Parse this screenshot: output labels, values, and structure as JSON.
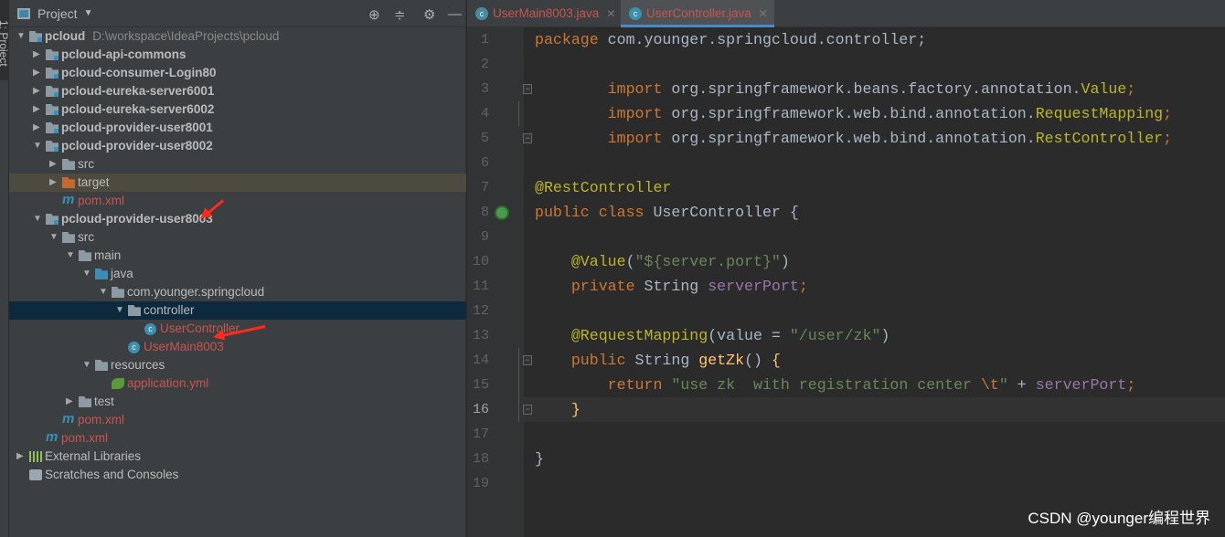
{
  "side_strip": {
    "label": "1: Project"
  },
  "project_panel": {
    "title": "Project",
    "toolbar_icons": [
      "locate-icon",
      "collapse-all-icon",
      "gear-icon",
      "minimize-icon"
    ],
    "tree": [
      {
        "level": 0,
        "arrow": "open",
        "icon": "module",
        "label": "pcloud",
        "path": "D:\\workspace\\IdeaProjects\\pcloud",
        "style": "bold"
      },
      {
        "level": 1,
        "arrow": "closed",
        "icon": "module",
        "label": "pcloud-api-commons",
        "style": "bold"
      },
      {
        "level": 1,
        "arrow": "closed",
        "icon": "module",
        "label": "pcloud-consumer-Login80",
        "style": "bold"
      },
      {
        "level": 1,
        "arrow": "closed",
        "icon": "module",
        "label": "pcloud-eureka-server6001",
        "style": "bold"
      },
      {
        "level": 1,
        "arrow": "closed",
        "icon": "module",
        "label": "pcloud-eureka-server6002",
        "style": "bold"
      },
      {
        "level": 1,
        "arrow": "closed",
        "icon": "module",
        "label": "pcloud-provider-user8001",
        "style": "bold"
      },
      {
        "level": 1,
        "arrow": "open",
        "icon": "module",
        "label": "pcloud-provider-user8002",
        "style": "bold"
      },
      {
        "level": 2,
        "arrow": "closed",
        "icon": "folder",
        "label": "src",
        "style": "normal"
      },
      {
        "level": 2,
        "arrow": "closed",
        "icon": "excluded-folder",
        "label": "target",
        "style": "normal",
        "row": "highlighted"
      },
      {
        "level": 2,
        "arrow": "none",
        "icon": "maven",
        "label": "pom.xml",
        "style": "red"
      },
      {
        "level": 1,
        "arrow": "open",
        "icon": "module",
        "label": "pcloud-provider-user8003",
        "style": "bold"
      },
      {
        "level": 2,
        "arrow": "open",
        "icon": "folder",
        "label": "src",
        "style": "normal"
      },
      {
        "level": 3,
        "arrow": "open",
        "icon": "folder",
        "label": "main",
        "style": "normal"
      },
      {
        "level": 4,
        "arrow": "open",
        "icon": "source-folder",
        "label": "java",
        "style": "normal"
      },
      {
        "level": 5,
        "arrow": "open",
        "icon": "package",
        "label": "com.younger.springcloud",
        "style": "normal"
      },
      {
        "level": 6,
        "arrow": "open",
        "icon": "package",
        "label": "controller",
        "style": "normal",
        "row": "selected"
      },
      {
        "level": 7,
        "arrow": "none",
        "icon": "class",
        "label": "UserController",
        "style": "red"
      },
      {
        "level": 6,
        "arrow": "none",
        "icon": "spring-boot-class",
        "label": "UserMain8003",
        "style": "red"
      },
      {
        "level": 4,
        "arrow": "open",
        "icon": "resources-folder",
        "label": "resources",
        "style": "normal"
      },
      {
        "level": 5,
        "arrow": "none",
        "icon": "spring-config",
        "label": "application.yml",
        "style": "red"
      },
      {
        "level": 3,
        "arrow": "closed",
        "icon": "folder",
        "label": "test",
        "style": "normal"
      },
      {
        "level": 2,
        "arrow": "none",
        "icon": "maven",
        "label": "pom.xml",
        "style": "red"
      },
      {
        "level": 1,
        "arrow": "none",
        "icon": "maven",
        "label": "pom.xml",
        "style": "red"
      },
      {
        "level": 0,
        "arrow": "closed",
        "icon": "libraries",
        "label": "External Libraries",
        "style": "normal"
      },
      {
        "level": 0,
        "arrow": "none",
        "icon": "scratches",
        "label": "Scratches and Consoles",
        "style": "normal"
      }
    ]
  },
  "editor_tabs": [
    {
      "label": "UserMain8003.java",
      "icon": "spring-boot-class-icon",
      "active": false
    },
    {
      "label": "UserController.java",
      "icon": "class-icon",
      "active": true
    }
  ],
  "editor": {
    "current_line": 16,
    "lines": [
      [
        [
          "package ",
          "k"
        ],
        [
          "com.younger.springcloud.controller;",
          "t"
        ]
      ],
      [],
      [
        [
          "        import ",
          "k"
        ],
        [
          "org.springframework.beans.factory.annotation.",
          "t"
        ],
        [
          "Value",
          "a"
        ],
        [
          ";",
          "k"
        ]
      ],
      [
        [
          "        import ",
          "k"
        ],
        [
          "org.springframework.web.bind.annotation.",
          "t"
        ],
        [
          "RequestMapping",
          "a"
        ],
        [
          ";",
          "k"
        ]
      ],
      [
        [
          "        import ",
          "k"
        ],
        [
          "org.springframework.web.bind.annotation.",
          "t"
        ],
        [
          "RestController",
          "a"
        ],
        [
          ";",
          "k"
        ]
      ],
      [],
      [
        [
          "@RestController",
          "a"
        ]
      ],
      [
        [
          "public class ",
          "k"
        ],
        [
          "UserController {",
          "t"
        ]
      ],
      [],
      [
        [
          "    @Value",
          "a"
        ],
        [
          "(",
          "t"
        ],
        [
          "\"${server.port}\"",
          "s"
        ],
        [
          ")",
          "t"
        ]
      ],
      [
        [
          "    private ",
          "k"
        ],
        [
          "String ",
          "t"
        ],
        [
          "serverPort",
          "f"
        ],
        [
          ";",
          "k"
        ]
      ],
      [],
      [
        [
          "    @RequestMapping",
          "a"
        ],
        [
          "(value = ",
          "t"
        ],
        [
          "\"/user/zk\"",
          "s"
        ],
        [
          ")",
          "t"
        ]
      ],
      [
        [
          "    public ",
          "k"
        ],
        [
          "String ",
          "t"
        ],
        [
          "getZk",
          "m"
        ],
        [
          "() ",
          "t"
        ],
        [
          "{",
          "m"
        ]
      ],
      [
        [
          "        return ",
          "k"
        ],
        [
          "\"use zk  with registration center ",
          "s"
        ],
        [
          "\\t",
          "k"
        ],
        [
          "\"",
          "s"
        ],
        [
          " + ",
          "t"
        ],
        [
          "serverPort",
          "f"
        ],
        [
          ";",
          "k"
        ]
      ],
      [
        [
          "    }",
          "m"
        ]
      ],
      [],
      [
        [
          "}",
          "t"
        ]
      ],
      []
    ]
  },
  "watermark": "CSDN @younger编程世界"
}
